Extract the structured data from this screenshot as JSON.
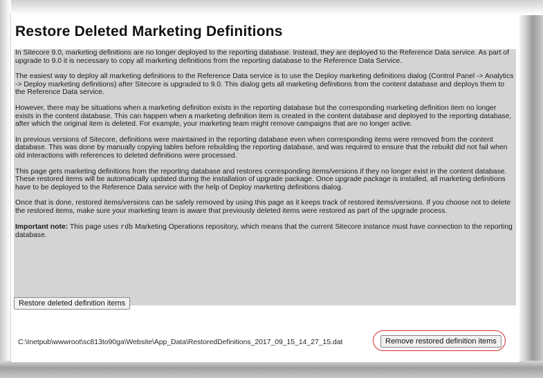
{
  "page": {
    "title": "Restore Deleted Marketing Definitions"
  },
  "content": {
    "para1": "In Sitecore 9.0, marketing definitions are no longer deployed to the reporting database. Instead, they are deployed to the Reference Data service. As part of upgrade to 9.0 it is necessary to copy all marketing definitions from the reporting database to the Reference Data Service.",
    "para2": "The easiest way to deploy all marketing definitions to the Reference Data service is to use the Deploy marketing definitions dialog (Control Panel -> Analytics -> Deploy marketing definitions) after Sitecore is upgraded to 9.0. This dialog gets all marketing definitions from the content database and deploys them to the Reference Data service.",
    "para3": "However, there may be situations when a marketing definition exists in the reporting database but the corresponding marketing definition item no longer exists in the content database. This can happen when a marketing definition item is created in the content database and deployed to the reporting database, after which the original item is deleted. For example, your marketing team might remove campaigns that are no longer active.",
    "para4": "In previous versions of Sitecore, definitions were maintained in the reporting database even when corresponding items were removed from the content database. This was done by manually copying tables before rebuilding the reporting database, and was required to ensure that the rebuild did not fail when old interactions with references to deleted definitions were processed.",
    "para5": "This page gets marketing definitions from the reporting database and restores corresponding items/versions if they no longer exist in the content database. These restored items will be automatically updated during the installation of upgrade package. Once upgrade package is installed, all marketing definitions have to be deployed to the Reference Data service with the help of Deploy marketing definitions dialog.",
    "para6": "Once that is done, restored items/versions can be safely removed by using this page as it keeps track of restored items/versions. If you choose not to delete the restored items, make sure your marketing team is aware that previously deleted items were restored as part of the upgrade process.",
    "note_label": "Important note:",
    "note_before": " This page uses ",
    "note_code": "rdb",
    "note_after": " Marketing Operations repository, which means that the current Sitecore instance must have connection to the reporting database."
  },
  "actions": {
    "restore_label": "Restore deleted definition items",
    "file_path": "C:\\Inetpub\\wwwroot\\sc813to90ga\\Website\\App_Data\\RestoredDefinitions_2017_09_15_14_27_15.dat",
    "remove_label": "Remove restored definition items"
  },
  "colors": {
    "content_background": "#d4d4d4",
    "highlight_ring": "#d43030"
  }
}
